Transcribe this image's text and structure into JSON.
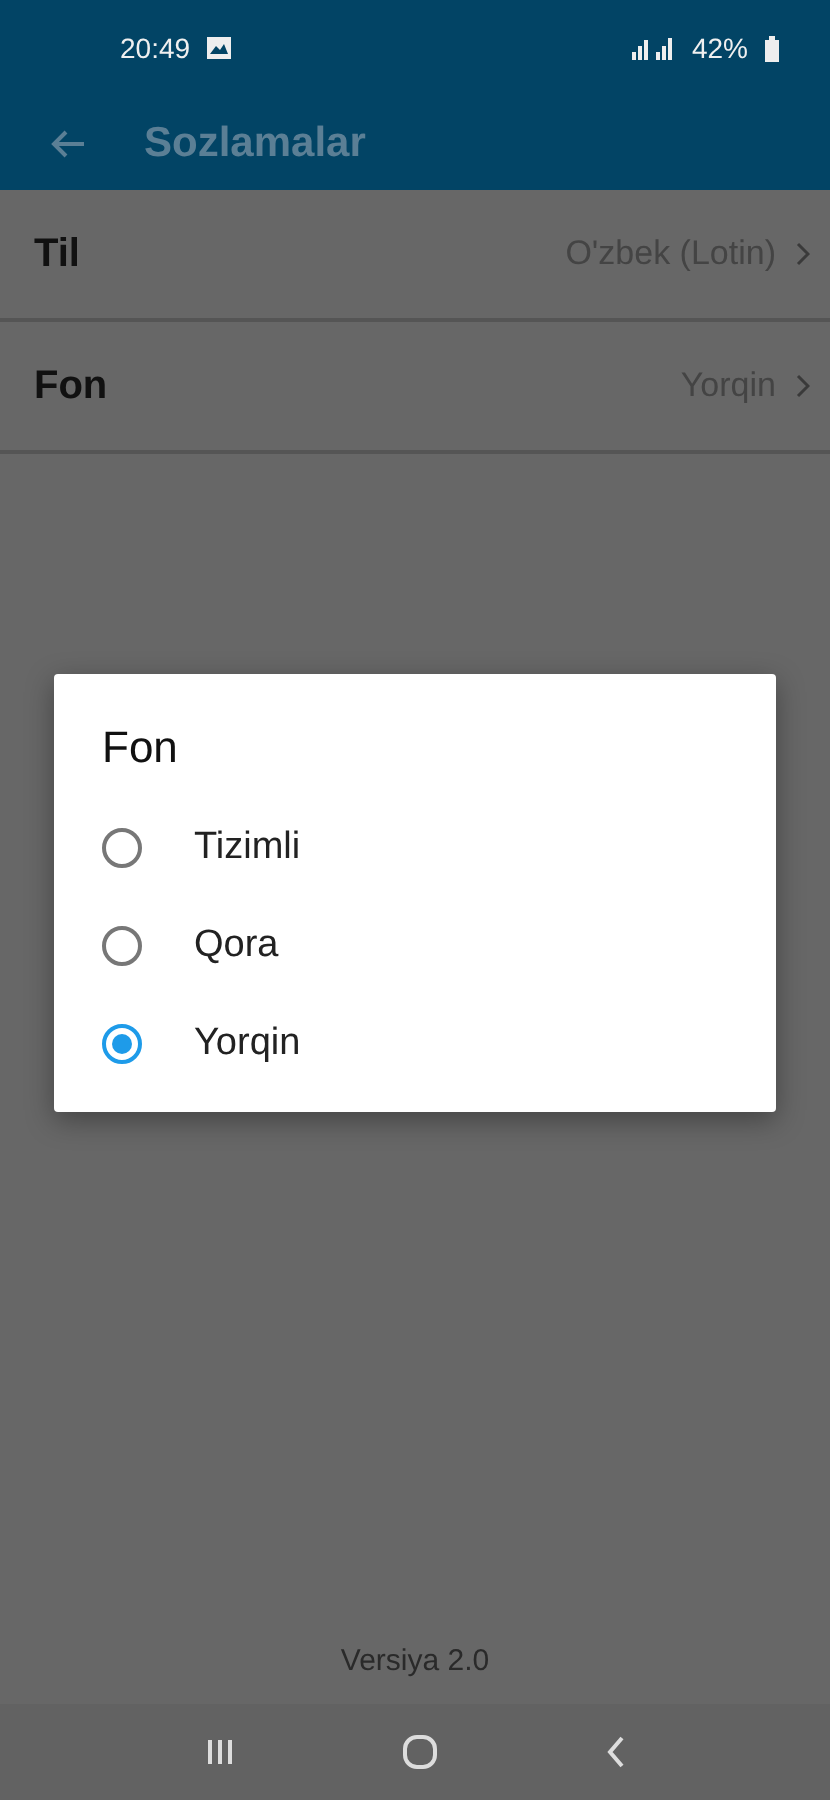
{
  "status_bar": {
    "time": "20:49",
    "battery": "42%"
  },
  "app_bar": {
    "title": "Sozlamalar"
  },
  "settings": [
    {
      "label": "Til",
      "value": "O'zbek (Lotin)"
    },
    {
      "label": "Fon",
      "value": "Yorqin"
    }
  ],
  "dialog": {
    "title": "Fon",
    "options": [
      {
        "label": "Tizimli",
        "selected": false
      },
      {
        "label": "Qora",
        "selected": false
      },
      {
        "label": "Yorqin",
        "selected": true
      }
    ]
  },
  "footer": {
    "version": "Versiya 2.0"
  }
}
